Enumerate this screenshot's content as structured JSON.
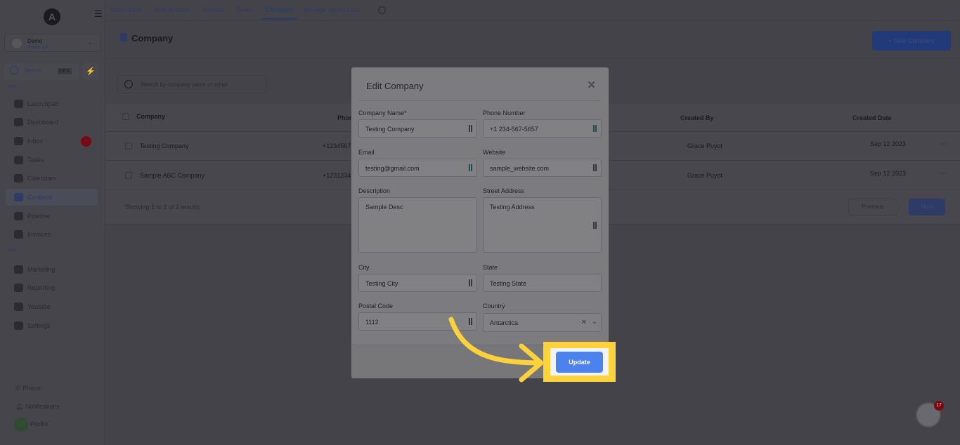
{
  "sidebar": {
    "location_name": "Demo",
    "location_city": "Irvine, CA",
    "search_label": "Search",
    "search_shortcut": "ctrl K",
    "apps_label": "Apps",
    "tools_label": "Tools",
    "apps": [
      {
        "label": "Launchpad"
      },
      {
        "label": "Dashboard"
      },
      {
        "label": "Inbox",
        "badge": "0"
      },
      {
        "label": "Tasks"
      },
      {
        "label": "Calendars"
      },
      {
        "label": "Contacts",
        "active": true
      },
      {
        "label": "Pipeline"
      },
      {
        "label": "Invoices"
      }
    ],
    "tools": [
      {
        "label": "Marketing"
      },
      {
        "label": "Reporting"
      },
      {
        "label": "Youtube"
      },
      {
        "label": "Settings"
      }
    ],
    "footer": {
      "phone": "Phone",
      "notifications": "Notifications",
      "profile": "Profile",
      "avatar_initials": "GP"
    }
  },
  "topnav": {
    "tabs": [
      "Smart Lists",
      "Bulk Actions",
      "Restore",
      "Tasks",
      "Company",
      "Manage Smart Lists"
    ],
    "active": "Company"
  },
  "page": {
    "title": "Company",
    "new_button": "+ New Company",
    "search_placeholder": "Search by company name or email"
  },
  "table": {
    "headers": [
      "Company",
      "Phone",
      "Created By",
      "Created Date"
    ],
    "rows": [
      {
        "company": "Testing Company",
        "phone": "+1234567",
        "created_by": "Grace Puyot",
        "date": "Sep 12 2023"
      },
      {
        "company": "Sample ABC Company",
        "phone": "+1231234",
        "created_by": "Grace Puyot",
        "date": "Sep 12 2023"
      }
    ],
    "summary": "Showing 1 to 2 of 2 results",
    "previous": "Previous",
    "next": "Next"
  },
  "modal": {
    "title": "Edit Company",
    "fields": {
      "company_name": {
        "label": "Company Name*",
        "value": "Testing Company"
      },
      "phone": {
        "label": "Phone Number",
        "value": "+1 234-567-5657"
      },
      "email": {
        "label": "Email",
        "value": "testing@gmail.com"
      },
      "website": {
        "label": "Website",
        "value": "sample_website.com"
      },
      "description": {
        "label": "Description",
        "value": "Sample Desc"
      },
      "street": {
        "label": "Street Address",
        "value": "Testing Address"
      },
      "city": {
        "label": "City",
        "value": "Testing City"
      },
      "state": {
        "label": "State",
        "value": "Testing State"
      },
      "postal": {
        "label": "Postal Code",
        "value": "1112"
      },
      "country": {
        "label": "Country",
        "value": "Antarctica"
      }
    },
    "update_button": "Update"
  },
  "chat": {
    "badge": "17"
  },
  "colors": {
    "highlight": "#ffd23c",
    "update_button": "#4c82ee",
    "overlay": "#434349"
  }
}
